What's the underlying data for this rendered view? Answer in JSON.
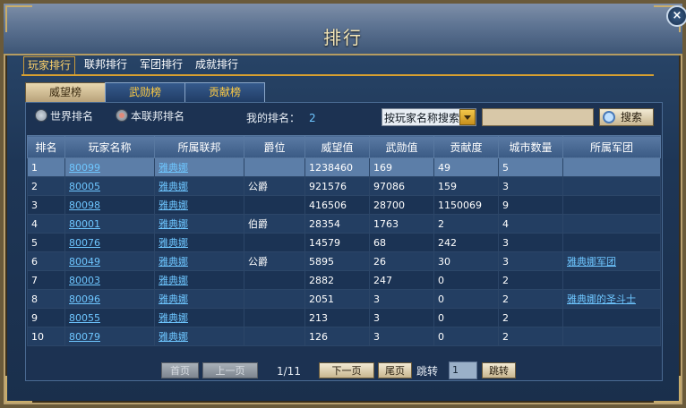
{
  "window": {
    "title": "排行",
    "close_label": "×"
  },
  "main_tabs": [
    {
      "label": "玩家排行",
      "active": true
    },
    {
      "label": "联邦排行",
      "active": false
    },
    {
      "label": "军团排行",
      "active": false
    },
    {
      "label": "成就排行",
      "active": false
    }
  ],
  "sub_tabs": [
    {
      "label": "威望榜",
      "active": true
    },
    {
      "label": "武勋榜",
      "active": false
    },
    {
      "label": "贡献榜",
      "active": false
    }
  ],
  "filters": {
    "world_label": "世界排名",
    "federation_label": "本联邦排名",
    "selected": "federation",
    "my_rank_label": "我的排名：",
    "my_rank_value": "2"
  },
  "search": {
    "select_value": "按玩家名称搜索",
    "input_value": "",
    "button_label": "搜索"
  },
  "table": {
    "columns": [
      "排名",
      "玩家名称",
      "所属联邦",
      "爵位",
      "威望值",
      "武勋值",
      "贡献度",
      "城市数量",
      "所属军团"
    ],
    "rows": [
      {
        "rank": "1",
        "name": "80099",
        "federation": "雅典娜",
        "title": "",
        "prestige": "1238460",
        "merit": "169",
        "contribution": "49",
        "cities": "5",
        "legion": ""
      },
      {
        "rank": "2",
        "name": "80005",
        "federation": "雅典娜",
        "title": "公爵",
        "prestige": "921576",
        "merit": "97086",
        "contribution": "159",
        "cities": "3",
        "legion": ""
      },
      {
        "rank": "3",
        "name": "80098",
        "federation": "雅典娜",
        "title": "",
        "prestige": "416506",
        "merit": "28700",
        "contribution": "1150069",
        "cities": "9",
        "legion": ""
      },
      {
        "rank": "4",
        "name": "80001",
        "federation": "雅典娜",
        "title": "伯爵",
        "prestige": "28354",
        "merit": "1763",
        "contribution": "2",
        "cities": "4",
        "legion": ""
      },
      {
        "rank": "5",
        "name": "80076",
        "federation": "雅典娜",
        "title": "",
        "prestige": "14579",
        "merit": "68",
        "contribution": "242",
        "cities": "3",
        "legion": ""
      },
      {
        "rank": "6",
        "name": "80049",
        "federation": "雅典娜",
        "title": "公爵",
        "prestige": "5895",
        "merit": "26",
        "contribution": "30",
        "cities": "3",
        "legion": "雅典娜军团"
      },
      {
        "rank": "7",
        "name": "80003",
        "federation": "雅典娜",
        "title": "",
        "prestige": "2882",
        "merit": "247",
        "contribution": "0",
        "cities": "2",
        "legion": ""
      },
      {
        "rank": "8",
        "name": "80096",
        "federation": "雅典娜",
        "title": "",
        "prestige": "2051",
        "merit": "3",
        "contribution": "0",
        "cities": "2",
        "legion": "雅典娜的圣斗士"
      },
      {
        "rank": "9",
        "name": "80055",
        "federation": "雅典娜",
        "title": "",
        "prestige": "213",
        "merit": "3",
        "contribution": "0",
        "cities": "2",
        "legion": ""
      },
      {
        "rank": "10",
        "name": "80079",
        "federation": "雅典娜",
        "title": "",
        "prestige": "126",
        "merit": "3",
        "contribution": "0",
        "cities": "2",
        "legion": ""
      }
    ],
    "selected_row": 0
  },
  "pagination": {
    "first_label": "首页",
    "prev_label": "上一页",
    "page_text": "1/11",
    "next_label": "下一页",
    "last_label": "尾页",
    "jump_label": "跳转",
    "jump_value": "1",
    "jump_button_label": "跳转"
  },
  "colors": {
    "link": "#6ec6ff",
    "active_tab_text": "#ffd36a",
    "tab_underline": "#d8a030"
  }
}
